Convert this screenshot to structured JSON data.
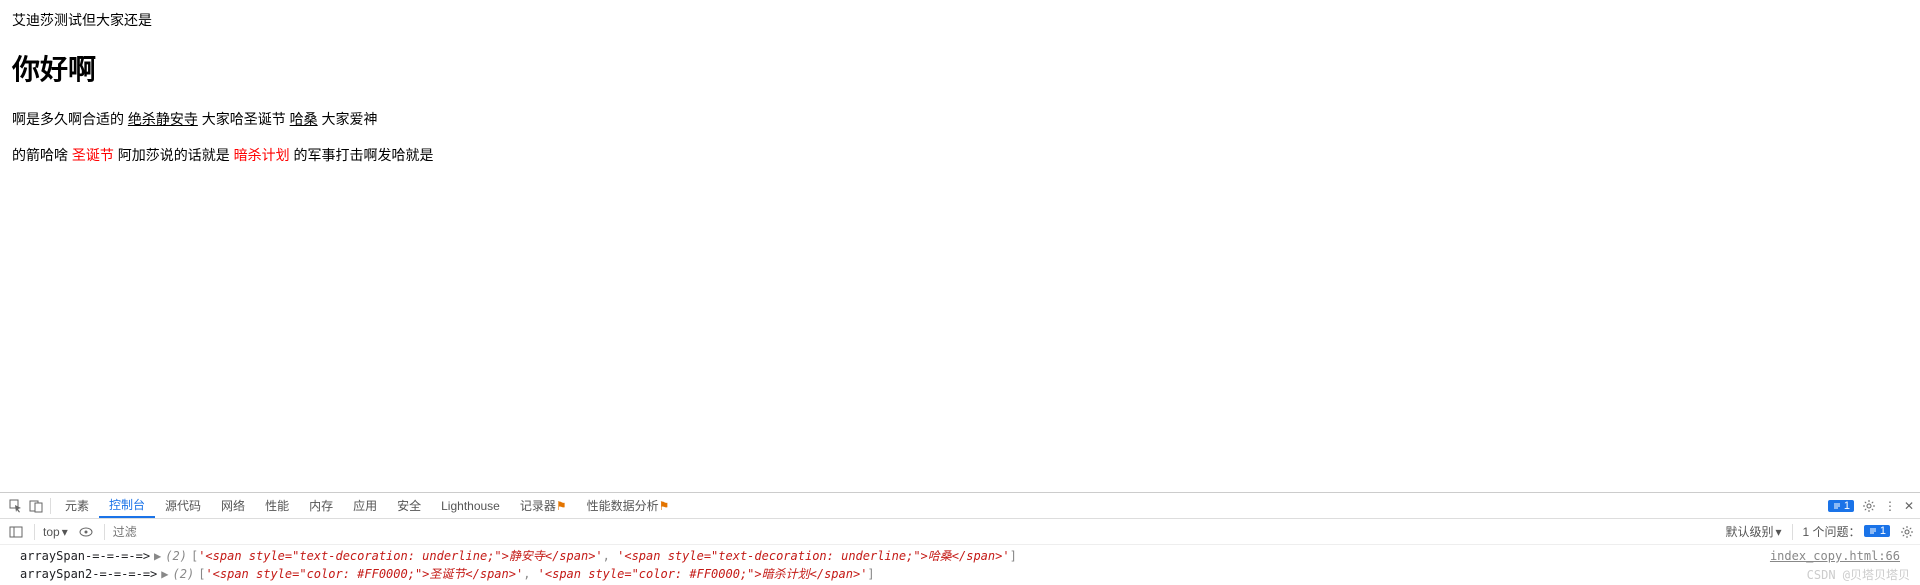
{
  "page": {
    "line1": "艾迪莎测试但大家还是",
    "heading": "你好啊",
    "para1": {
      "t1": "啊是多久啊合适的 ",
      "u1": "绝杀静安寺",
      "t2": " 大家哈圣诞节 ",
      "u2": "哈桑",
      "t3": " 大家爱神"
    },
    "para2": {
      "t1": "的箭哈啥 ",
      "r1": "圣诞节",
      "t2": " 阿加莎说的话就是 ",
      "r2": "暗杀计划",
      "t3": " 的军事打击啊发哈就是"
    }
  },
  "devtools": {
    "tabs": [
      "元素",
      "控制台",
      "源代码",
      "网络",
      "性能",
      "内存",
      "应用",
      "安全",
      "Lighthouse",
      "记录器",
      "性能数据分析"
    ],
    "active_tab": 1,
    "experimental_badge": "⚠",
    "issue_count": "1",
    "toolbar": {
      "top": "top",
      "filter_placeholder": "过滤",
      "default_level": "默认级别",
      "issues_label": "1 个问题：",
      "issues_count": "1"
    },
    "console": {
      "source_link": "index_copy.html:66",
      "rows": [
        {
          "label": "arraySpan-=-=-=-=>",
          "len": "(2)",
          "items": [
            "'<span style=\"text-decoration: underline;\">静安寺</span>'",
            "'<span style=\"text-decoration: underline;\">哈桑</span>'"
          ]
        },
        {
          "label": "arraySpan2-=-=-=-=>",
          "len": "(2)",
          "items": [
            "'<span style=\"color: #FF0000;\">圣诞节</span>'",
            "'<span style=\"color: #FF0000;\">暗杀计划</span>'"
          ]
        }
      ]
    },
    "watermark": "CSDN @贝塔贝塔贝"
  }
}
